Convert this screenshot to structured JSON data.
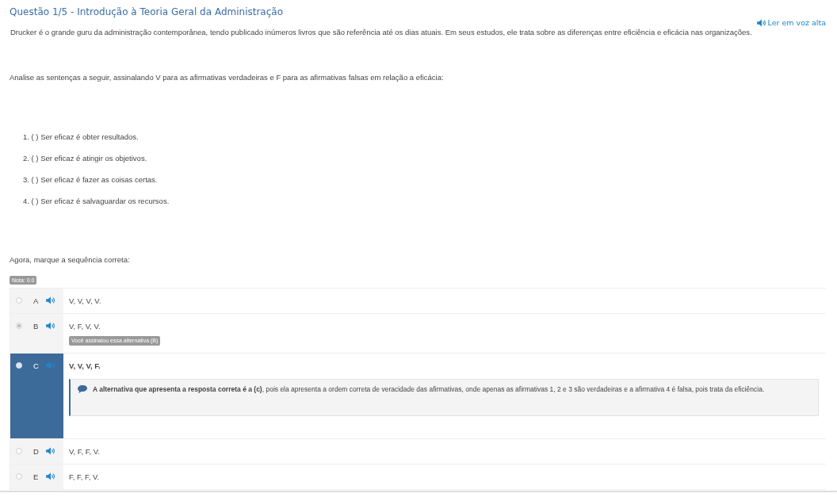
{
  "question": {
    "title": "Questão 1/5 - Introdução à Teoria Geral da Administração",
    "read_aloud": "Ler em voz alta",
    "paragraphs": [
      "Drucker é o grande guru da administração contemporânea, tendo publicado inúmeros livros que são referência até os dias atuais. Em seus estudos, ele trata sobre as diferenças entre eficiência e eficácia nas organizações.",
      "Analise as sentenças a seguir, assinalando V para as afirmativas verdadeiras e F para as afirmativas falsas em relação a eficácia:"
    ],
    "statements": [
      "1. ( ) Ser eficaz é obter resultados.",
      "2. ( ) Ser eficaz é atingir os objetivos.",
      "3. ( ) Ser eficaz é fazer as coisas certas.",
      "4. ( ) Ser eficaz é salvaguardar os recursos."
    ],
    "prompt": "Agora, marque a sequência correta:"
  },
  "grade": "Nota: 0.0",
  "options": [
    {
      "letter": "A",
      "text": "V, V, V, V.",
      "selected": false,
      "correct": false
    },
    {
      "letter": "B",
      "text": "V, F, V, V.",
      "selected": true,
      "correct": false,
      "badge": "Você assinalou essa alternativa (B)"
    },
    {
      "letter": "C",
      "text": "V, V, V, F.",
      "selected": false,
      "correct": true,
      "feedback": "**A alternativa que apresenta a resposta correta é a (c)**, pois ela apresenta a ordem correta de veracidade das afirmativas, onde apenas as afirmativas 1, 2 e 3 são verdadeiras e a afirmativa 4 é falsa, pois trata da eficiência."
    },
    {
      "letter": "D",
      "text": "V, F, F, V.",
      "selected": false,
      "correct": false
    },
    {
      "letter": "E",
      "text": "F, F, F, V.",
      "selected": false,
      "correct": false
    }
  ]
}
